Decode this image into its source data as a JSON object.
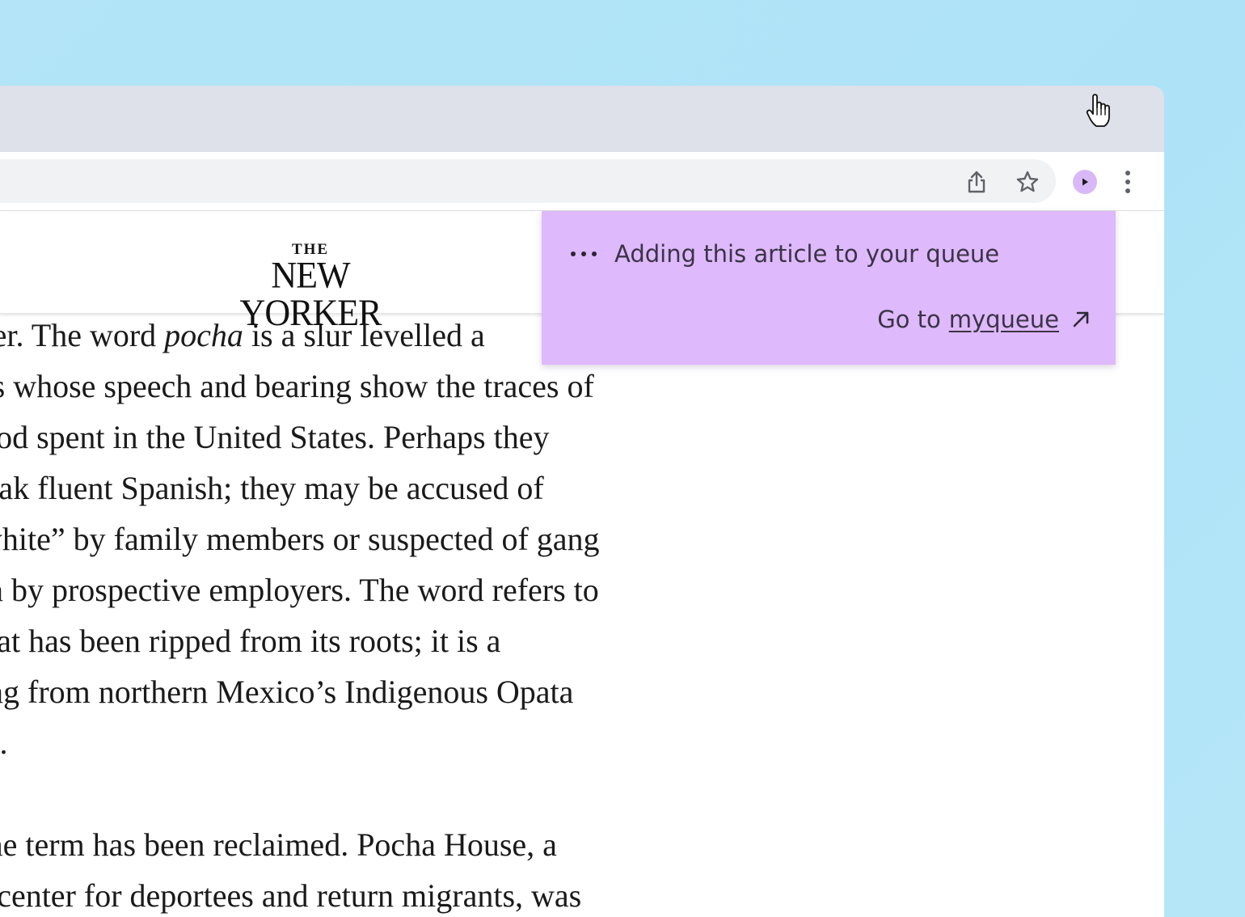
{
  "browser": {
    "icons": {
      "share": "share-icon",
      "bookmark": "star-icon",
      "extension": "play-icon",
      "menu": "kebab-menu-icon"
    }
  },
  "site": {
    "logo_the": "THE",
    "logo_name": "NEW YORKER"
  },
  "article": {
    "lines": [
      {
        "before": "center. The word ",
        "em": "pocha",
        "after": " is a slur levelled a"
      },
      {
        "text": "icans whose speech and bearing show the traces of"
      },
      {
        "text": "ldhood spent in the United States. Perhaps they"
      },
      {
        "text": "t speak fluent Spanish; they may be accused of"
      },
      {
        "text": "ng white” by family members or suspected of gang"
      },
      {
        "text": "ation by prospective employers. The word refers to"
      },
      {
        "text": "nt that has been ripped from its roots; it is a"
      },
      {
        "text": "owing from northern Mexico’s Indigenous Opata"
      },
      {
        "text": "uage."
      },
      {
        "text": "ly, the term has been reclaimed. Pocha House, a"
      },
      {
        "text": "ural center for deportees and return migrants, was"
      }
    ]
  },
  "popup": {
    "status_text": "Adding this article to your queue",
    "go_to_label": "Go to",
    "link_text": "myqueue",
    "accent_color": "#deb9fb"
  }
}
